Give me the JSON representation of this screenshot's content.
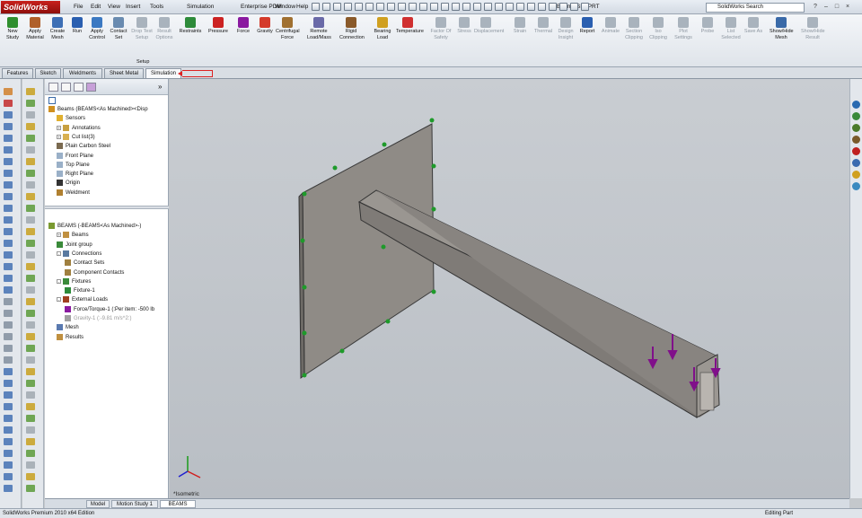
{
  "app": {
    "logo": "SolidWorks",
    "doc_title": "Beams.SLDPRT"
  },
  "menu": [
    "File",
    "Edit",
    "View",
    "Insert",
    "Tools",
    "Simulation",
    "Enterprise PDM",
    "Window",
    "Help"
  ],
  "search": {
    "placeholder": "SolidWorks Search"
  },
  "window_buttons": [
    "?",
    "–",
    "□",
    "×"
  ],
  "commands": [
    {
      "label": "New Study",
      "icon": "new-study-icon",
      "color": "#2f8f2f",
      "enabled": true
    },
    {
      "label": "Apply Material",
      "icon": "apply-material-icon",
      "color": "#b0602a",
      "enabled": true
    },
    {
      "label": "Create Mesh",
      "icon": "mesh-icon",
      "color": "#3d6fb5",
      "enabled": true
    },
    {
      "label": "Run",
      "icon": "run-icon",
      "color": "#2a5fb0",
      "enabled": true
    },
    {
      "label": "Apply Control",
      "icon": "apply-control-icon",
      "color": "#3c79c2",
      "enabled": true
    },
    {
      "label": "Contact Set",
      "icon": "contact-set-icon",
      "color": "#6a8bb0",
      "enabled": true
    },
    {
      "label": "Drop Test Setup",
      "icon": "drop-test-icon",
      "color": "#a9b3bd",
      "enabled": false
    },
    {
      "label": "Result Options",
      "icon": "result-options-icon",
      "color": "#a9b3bd",
      "enabled": false
    },
    {
      "label": "Restraints",
      "icon": "restraints-icon",
      "color": "#2e8b3a",
      "enabled": true
    },
    {
      "label": "Pressure",
      "icon": "pressure-icon",
      "color": "#cc2222",
      "enabled": true
    },
    {
      "label": "Force",
      "icon": "force-icon",
      "color": "#8a1aa0",
      "enabled": true
    },
    {
      "label": "Gravity",
      "icon": "gravity-icon",
      "color": "#d43a2a",
      "enabled": true
    },
    {
      "label": "Centrifugal Force",
      "icon": "centrifugal-icon",
      "color": "#a07030",
      "enabled": true
    },
    {
      "label": "Remote Load/Mass",
      "icon": "remote-load-icon",
      "color": "#6a6aa8",
      "enabled": true
    },
    {
      "label": "Rigid Connection",
      "icon": "rigid-connection-icon",
      "color": "#8a5a2a",
      "enabled": true
    },
    {
      "label": "Bearing Load",
      "icon": "bearing-load-icon",
      "color": "#d0a020",
      "enabled": true
    },
    {
      "label": "Temperature",
      "icon": "temperature-icon",
      "color": "#d03030",
      "enabled": true
    },
    {
      "label": "Factor Of Safety",
      "icon": "factor-of-safety-icon",
      "color": "#a9b3bd",
      "enabled": false
    },
    {
      "label": "Stress",
      "icon": "stress-icon",
      "color": "#a9b3bd",
      "enabled": false
    },
    {
      "label": "Displacement",
      "icon": "displacement-icon",
      "color": "#a9b3bd",
      "enabled": false
    },
    {
      "label": "Strain",
      "icon": "strain-icon",
      "color": "#a9b3bd",
      "enabled": false
    },
    {
      "label": "Thermal",
      "icon": "thermal-icon",
      "color": "#a9b3bd",
      "enabled": false
    },
    {
      "label": "Design Insight",
      "icon": "design-insight-icon",
      "color": "#a9b3bd",
      "enabled": false
    },
    {
      "label": "Report",
      "icon": "report-icon",
      "color": "#2a5fb0",
      "enabled": true
    },
    {
      "label": "Animate",
      "icon": "animate-icon",
      "color": "#a9b3bd",
      "enabled": false
    },
    {
      "label": "Section Clipping",
      "icon": "section-clipping-icon",
      "color": "#a9b3bd",
      "enabled": false
    },
    {
      "label": "Iso Clipping",
      "icon": "iso-clipping-icon",
      "color": "#a9b3bd",
      "enabled": false
    },
    {
      "label": "Plot Settings",
      "icon": "plot-settings-icon",
      "color": "#a9b3bd",
      "enabled": false
    },
    {
      "label": "Probe",
      "icon": "probe-icon",
      "color": "#a9b3bd",
      "enabled": false
    },
    {
      "label": "List Selected",
      "icon": "list-selected-icon",
      "color": "#a9b3bd",
      "enabled": false
    },
    {
      "label": "Save As",
      "icon": "save-as-icon",
      "color": "#a9b3bd",
      "enabled": false
    },
    {
      "label": "Show/Hide Mesh",
      "icon": "show-hide-mesh-icon",
      "color": "#3a6aa8",
      "enabled": true
    },
    {
      "label": "Show/Hide Result",
      "icon": "show-hide-result-icon",
      "color": "#a9b3bd",
      "enabled": false
    }
  ],
  "cmd_group_label": "Setup",
  "tabs": [
    "Features",
    "Sketch",
    "Weldments",
    "Sheet Metal",
    "Simulation"
  ],
  "active_tab": "Simulation",
  "feature_tree": [
    {
      "label": "Beams  (BEAMS<As Machined><Disp",
      "icon": "part-icon",
      "indent": 0,
      "color": "#d09020",
      "exp": ""
    },
    {
      "label": "Sensors",
      "icon": "sensors-icon",
      "indent": 1,
      "color": "#e0b030",
      "exp": ""
    },
    {
      "label": "Annotations",
      "icon": "annotations-icon",
      "indent": 1,
      "color": "#c8a040",
      "exp": "+"
    },
    {
      "label": "Cut list(3)",
      "icon": "cut-list-icon",
      "indent": 1,
      "color": "#d8b050",
      "exp": "+"
    },
    {
      "label": "Plain Carbon Steel",
      "icon": "material-icon",
      "indent": 1,
      "color": "#7a6a50",
      "exp": ""
    },
    {
      "label": "Front Plane",
      "icon": "plane-icon",
      "indent": 1,
      "color": "#9ab0c8",
      "exp": ""
    },
    {
      "label": "Top Plane",
      "icon": "plane-icon",
      "indent": 1,
      "color": "#9ab0c8",
      "exp": ""
    },
    {
      "label": "Right Plane",
      "icon": "plane-icon",
      "indent": 1,
      "color": "#9ab0c8",
      "exp": ""
    },
    {
      "label": "Origin",
      "icon": "origin-icon",
      "indent": 1,
      "color": "#333333",
      "exp": ""
    },
    {
      "label": "Weldment",
      "icon": "weldment-icon",
      "indent": 1,
      "color": "#b08030",
      "exp": ""
    }
  ],
  "study_tree": [
    {
      "label": "BEAMS (-BEAMS<As Machined>-)",
      "icon": "study-icon",
      "indent": 0,
      "color": "#7a9a30",
      "exp": ""
    },
    {
      "label": "Beams",
      "icon": "beams-icon",
      "indent": 1,
      "color": "#c09040",
      "exp": "+"
    },
    {
      "label": "Joint group",
      "icon": "joint-group-icon",
      "indent": 1,
      "color": "#3a8a3a",
      "exp": ""
    },
    {
      "label": "Connections",
      "icon": "connections-icon",
      "indent": 1,
      "color": "#5a7aa0",
      "exp": "-"
    },
    {
      "label": "Contact Sets",
      "icon": "contact-sets-icon",
      "indent": 2,
      "color": "#a08040",
      "exp": ""
    },
    {
      "label": "Component Contacts",
      "icon": "component-contacts-icon",
      "indent": 2,
      "color": "#a08040",
      "exp": ""
    },
    {
      "label": "Fixtures",
      "icon": "fixtures-icon",
      "indent": 1,
      "color": "#3a8a3a",
      "exp": "-"
    },
    {
      "label": "Fixture-1",
      "icon": "fixture-icon",
      "indent": 2,
      "color": "#2e8b3a",
      "exp": ""
    },
    {
      "label": "External Loads",
      "icon": "external-loads-icon",
      "indent": 1,
      "color": "#a04020",
      "exp": "-"
    },
    {
      "label": "Force/Torque-1 (:Per item: -500 lb",
      "icon": "force-torque-icon",
      "indent": 2,
      "color": "#8a1aa0",
      "exp": ""
    },
    {
      "label": "Gravity-1 (:-9.81 m/s^2:)",
      "icon": "gravity-load-icon",
      "indent": 2,
      "color": "#a0a0a0",
      "exp": ""
    },
    {
      "label": "Mesh",
      "icon": "mesh-tree-icon",
      "indent": 1,
      "color": "#5a7ab0",
      "exp": ""
    },
    {
      "label": "Results",
      "icon": "results-icon",
      "indent": 1,
      "color": "#c09040",
      "exp": ""
    }
  ],
  "viewport": {
    "orientation": "*Isometric",
    "background": "#c2c6cb",
    "part_color": "#8f8b86",
    "load_color": "#80108a",
    "fixture_color": "#1e9a2a"
  },
  "bottom_tabs": [
    "Model",
    "Motion Study 1",
    "BEAMS"
  ],
  "active_bottom_tab": "BEAMS",
  "status": {
    "left": "SolidWorks Premium 2010 x64 Edition",
    "right": "Editing Part"
  }
}
